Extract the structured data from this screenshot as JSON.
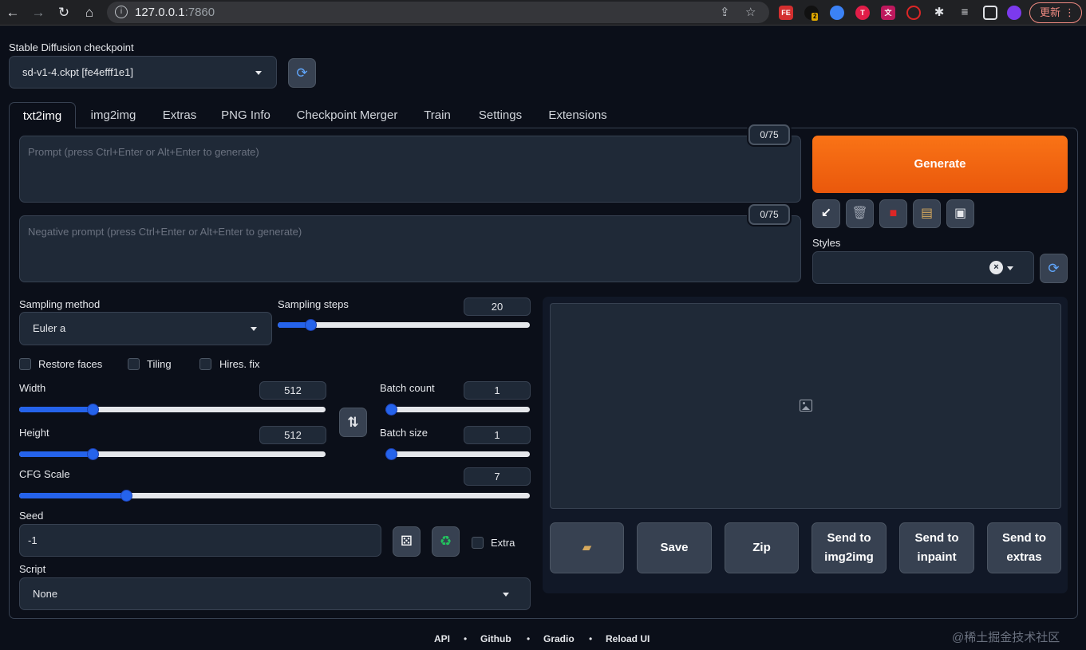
{
  "browser": {
    "url_host": "127.0.0.1",
    "url_port": ":7860",
    "update_label": "更新",
    "ext_badge": "2"
  },
  "checkpoint": {
    "label": "Stable Diffusion checkpoint",
    "value": "sd-v1-4.ckpt [fe4efff1e1]"
  },
  "tabs": [
    "txt2img",
    "img2img",
    "Extras",
    "PNG Info",
    "Checkpoint Merger",
    "Train",
    "Settings",
    "Extensions"
  ],
  "prompt": {
    "placeholder": "Prompt (press Ctrl+Enter or Alt+Enter to generate)",
    "counter": "0/75"
  },
  "negative_prompt": {
    "placeholder": "Negative prompt (press Ctrl+Enter or Alt+Enter to generate)",
    "counter": "0/75"
  },
  "generate_label": "Generate",
  "styles_label": "Styles",
  "sampling": {
    "method_label": "Sampling method",
    "method_value": "Euler a",
    "steps_label": "Sampling steps",
    "steps_value": "20",
    "steps_fraction": 0.13
  },
  "checkboxes": {
    "restore_faces": "Restore faces",
    "tiling": "Tiling",
    "hires_fix": "Hires. fix"
  },
  "width": {
    "label": "Width",
    "value": "512",
    "fraction": 0.24
  },
  "height": {
    "label": "Height",
    "value": "512",
    "fraction": 0.24
  },
  "batch_count": {
    "label": "Batch count",
    "value": "1",
    "fraction": 0.0
  },
  "batch_size": {
    "label": "Batch size",
    "value": "1",
    "fraction": 0.0
  },
  "cfg_scale": {
    "label": "CFG Scale",
    "value": "7",
    "fraction": 0.21
  },
  "seed": {
    "label": "Seed",
    "value": "-1",
    "extra_label": "Extra"
  },
  "script": {
    "label": "Script",
    "value": "None"
  },
  "actions": {
    "save": "Save",
    "zip": "Zip",
    "send_img2img": "Send to img2img",
    "send_inpaint": "Send to inpaint",
    "send_extras": "Send to extras"
  },
  "footer": {
    "api": "API",
    "github": "Github",
    "gradio": "Gradio",
    "reload": "Reload UI",
    "separator": "•"
  },
  "watermark": "@稀土掘金技术社区",
  "colors": {
    "accent": "#2563eb",
    "generate": "#ea580c",
    "background": "#0b0f19"
  },
  "icons": [
    "refresh-icon",
    "arrow-icon",
    "trash-icon",
    "red-card-icon",
    "clipboard-icon",
    "floppy-icon",
    "dice-icon",
    "recycle-icon",
    "swap-icon",
    "folder-icon",
    "image-icon"
  ]
}
